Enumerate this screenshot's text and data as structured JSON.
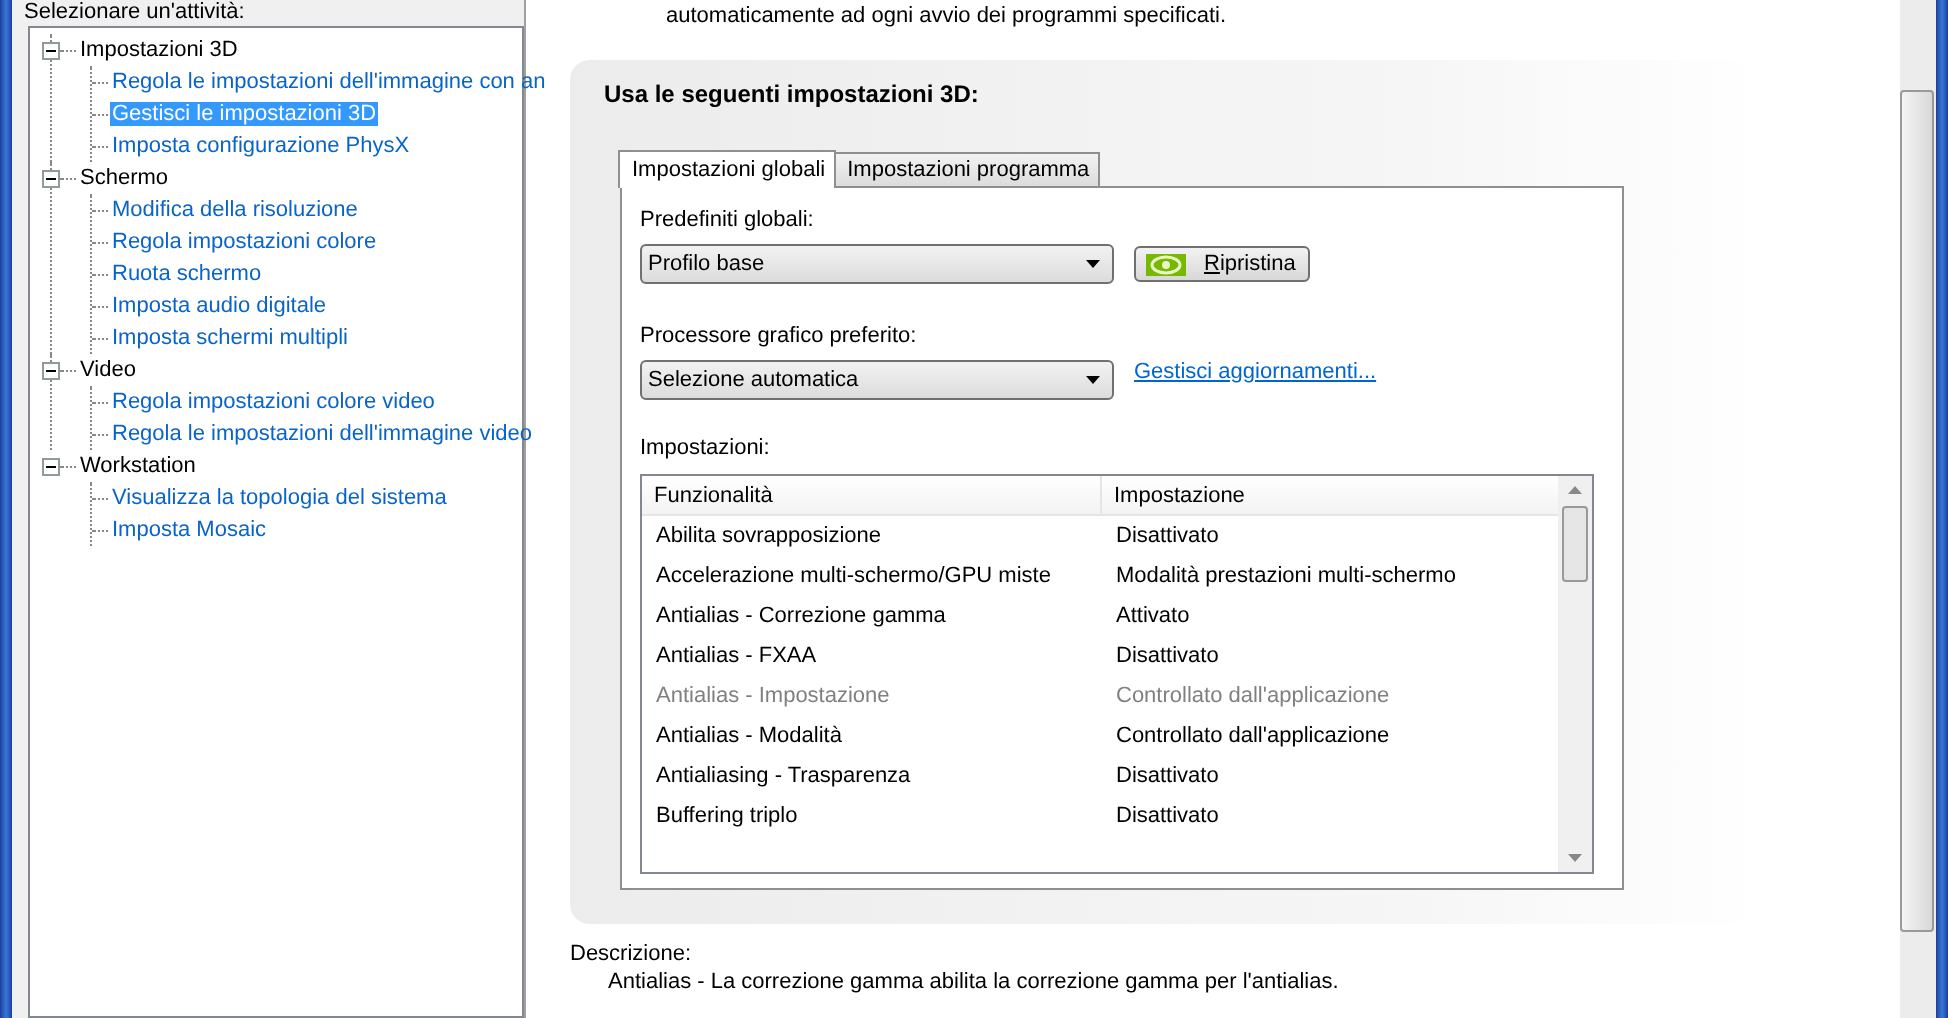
{
  "tree": {
    "title": "Selezionare un'attività:",
    "nodes": [
      {
        "label": "Impostazioni 3D",
        "expanded": true,
        "children": [
          {
            "label": "Regola le impostazioni dell'immagine con an",
            "selected": false
          },
          {
            "label": "Gestisci le impostazioni 3D",
            "selected": true
          },
          {
            "label": "Imposta configurazione PhysX",
            "selected": false
          }
        ]
      },
      {
        "label": "Schermo",
        "expanded": true,
        "children": [
          {
            "label": "Modifica della risoluzione",
            "selected": false
          },
          {
            "label": "Regola impostazioni colore",
            "selected": false
          },
          {
            "label": "Ruota schermo",
            "selected": false
          },
          {
            "label": "Imposta audio digitale",
            "selected": false
          },
          {
            "label": "Imposta schermi multipli",
            "selected": false
          }
        ]
      },
      {
        "label": "Video",
        "expanded": true,
        "children": [
          {
            "label": "Regola impostazioni colore video",
            "selected": false
          },
          {
            "label": "Regola le impostazioni dell'immagine video",
            "selected": false
          }
        ]
      },
      {
        "label": "Workstation",
        "expanded": true,
        "children": [
          {
            "label": "Visualizza la topologia del sistema",
            "selected": false
          },
          {
            "label": "Imposta Mosaic",
            "selected": false
          }
        ]
      }
    ]
  },
  "intro": "automaticamente ad ogni avvio dei programmi specificati.",
  "panel": {
    "heading": "Usa le seguenti impostazioni 3D:",
    "tabs": [
      {
        "label": "Impostazioni globali",
        "selected": true
      },
      {
        "label": "Impostazioni programma",
        "selected": false
      }
    ],
    "presets": {
      "label": "Predefiniti globali:",
      "value": "Profilo base",
      "button": "Ripristina"
    },
    "gpu": {
      "label": "Processore grafico preferito:",
      "value": "Selezione automatica",
      "link": "Gestisci aggiornamenti..."
    },
    "settings": {
      "label": "Impostazioni:",
      "columns": [
        "Funzionalità",
        "Impostazione"
      ],
      "rows": [
        {
          "feature": "Abilita sovrapposizione",
          "value": "Disattivato",
          "disabled": false
        },
        {
          "feature": "Accelerazione multi-schermo/GPU miste",
          "value": "Modalità prestazioni multi-schermo",
          "disabled": false
        },
        {
          "feature": "Antialias - Correzione gamma",
          "value": "Attivato",
          "disabled": false
        },
        {
          "feature": "Antialias - FXAA",
          "value": "Disattivato",
          "disabled": false
        },
        {
          "feature": "Antialias - Impostazione",
          "value": "Controllato dall'applicazione",
          "disabled": true
        },
        {
          "feature": "Antialias - Modalità",
          "value": "Controllato dall'applicazione",
          "disabled": false
        },
        {
          "feature": "Antialiasing - Trasparenza",
          "value": "Disattivato",
          "disabled": false
        },
        {
          "feature": "Buffering triplo",
          "value": "Disattivato",
          "disabled": false
        }
      ]
    }
  },
  "description": {
    "label": "Descrizione:",
    "text": "Antialias - La correzione gamma abilita la correzione gamma per l'antialias."
  }
}
